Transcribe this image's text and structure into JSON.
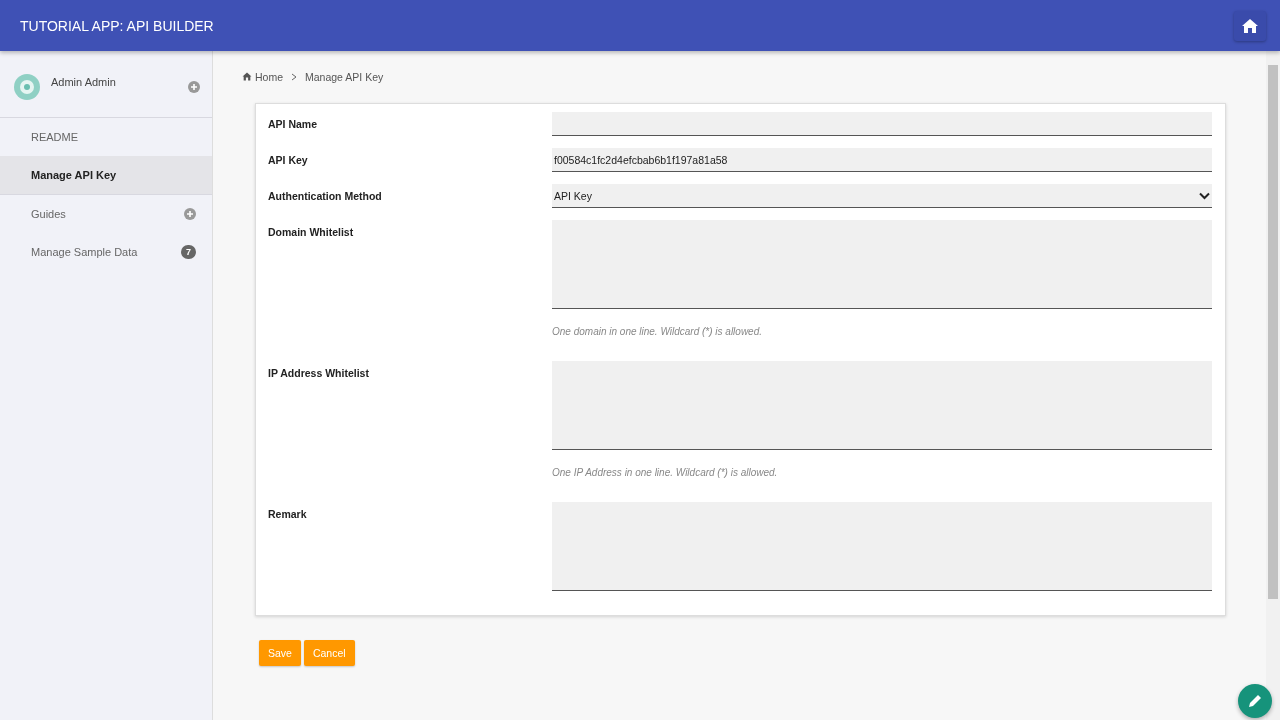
{
  "header": {
    "title": "TUTORIAL APP: API BUILDER"
  },
  "sidebar": {
    "user": {
      "name": "Admin Admin"
    },
    "items": [
      {
        "label": "README",
        "kind": "plain",
        "selected": false
      },
      {
        "label": "Manage API Key",
        "kind": "plain",
        "selected": true
      },
      {
        "label": "Guides",
        "kind": "expandable",
        "selected": false
      },
      {
        "label": "Manage Sample Data",
        "kind": "badge",
        "badge": "7",
        "selected": false
      }
    ]
  },
  "breadcrumb": [
    {
      "label": "Home",
      "kind": "home"
    },
    {
      "label": "Manage API Key",
      "kind": "current"
    }
  ],
  "form": {
    "fields": [
      {
        "label": "API Name",
        "kind": "text"
      },
      {
        "label": "API Key",
        "kind": "text",
        "value": "f00584c1fc2d4efcbab6b1f197a81a58"
      },
      {
        "label": "Authentication Method",
        "kind": "select",
        "value": "API Key"
      },
      {
        "label": "Domain Whitelist",
        "kind": "textarea",
        "help": "One domain in one line. Wildcard (*) is allowed."
      },
      {
        "label": "IP Address Whitelist",
        "kind": "textarea",
        "help": "One IP Address in one line. Wildcard (*) is allowed."
      },
      {
        "label": "Remark",
        "kind": "textarea"
      }
    ]
  },
  "buttons": [
    {
      "label": "Save"
    },
    {
      "label": "Cancel"
    }
  ]
}
